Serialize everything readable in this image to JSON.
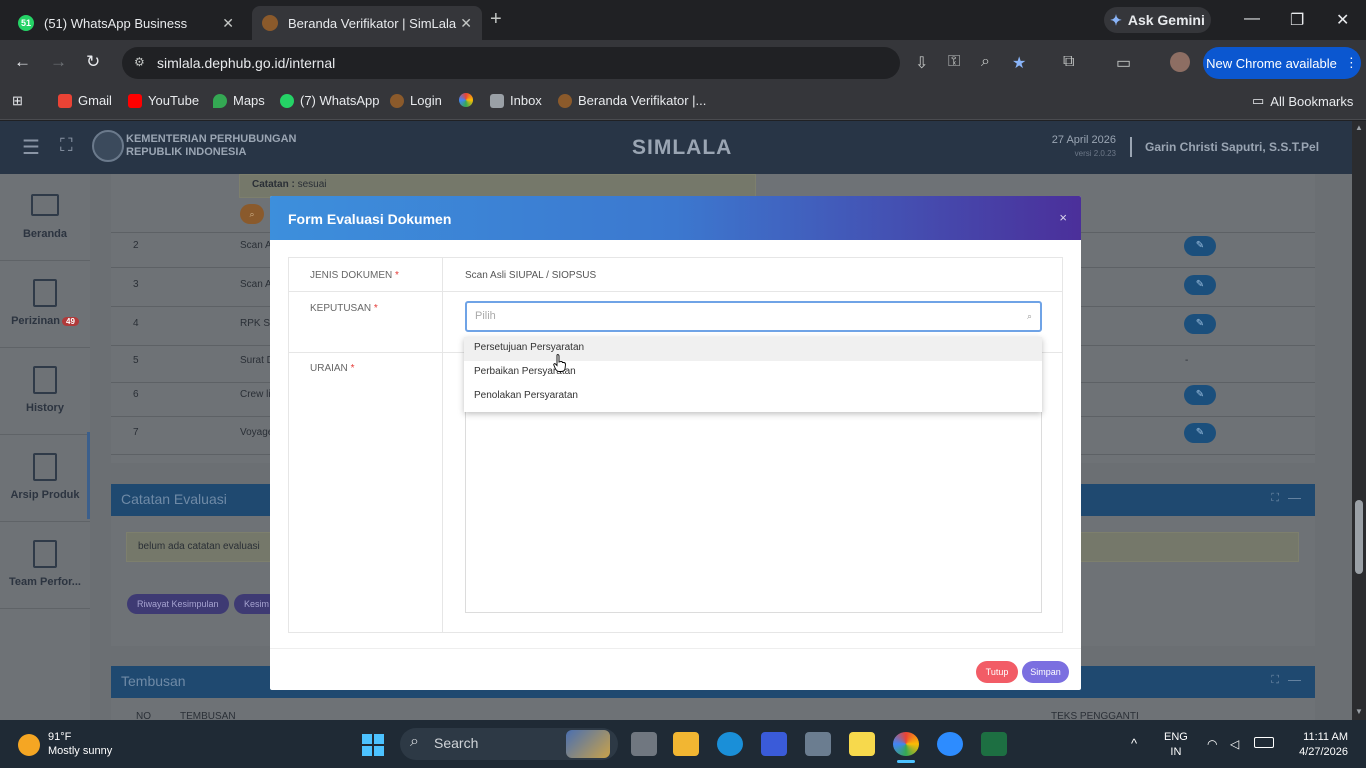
{
  "browser": {
    "tabs": [
      {
        "label": "(51) WhatsApp Business",
        "icon": "whatsapp-icon",
        "favtext": "51",
        "active": false
      },
      {
        "label": "Beranda Verifikator | SimLala",
        "icon": "simlala-icon",
        "favtext": "",
        "active": true
      }
    ],
    "ask_gemini": "Ask Gemini",
    "url": "simlala.dephub.go.id/internal",
    "new_chrome": "New Chrome available",
    "bookmarks": [
      {
        "label": "Gmail",
        "color": "#ea4335"
      },
      {
        "label": "YouTube",
        "color": "#ff0000"
      },
      {
        "label": "Maps",
        "color": "#34a853"
      },
      {
        "label": "(7) WhatsApp",
        "color": "#25d366"
      },
      {
        "label": "Login",
        "color": "#8b5a2b"
      },
      {
        "label": "",
        "color": "#fbbc04"
      },
      {
        "label": "Inbox",
        "color": "#9aa0a6"
      },
      {
        "label": "Beranda Verifikator |...",
        "color": "#8b5a2b"
      }
    ],
    "all_bookmarks": "All Bookmarks"
  },
  "app": {
    "ministry_line1": "KEMENTERIAN PERHUBUNGAN",
    "ministry_line2": "REPUBLIK INDONESIA",
    "brand": "SIMLALA",
    "date": "27 April 2026",
    "version": "versi 2.0.23",
    "user": "Garin Christi Saputri, S.S.T.Pel"
  },
  "sidebar": [
    {
      "label": "Beranda",
      "icon": "monitor-icon",
      "badge": ""
    },
    {
      "label": "Perizinan",
      "icon": "document-icon",
      "badge": "49"
    },
    {
      "label": "History",
      "icon": "document-icon",
      "badge": ""
    },
    {
      "label": "Arsip Produk",
      "icon": "document-icon",
      "badge": ""
    },
    {
      "label": "Team Perfor...",
      "icon": "document-icon",
      "badge": ""
    }
  ],
  "background": {
    "catatan_label": "Catatan :",
    "catatan_value": "sesuai",
    "rows": [
      {
        "no": "2",
        "name": "Scan A",
        "has_edit": true
      },
      {
        "no": "3",
        "name": "Scan A",
        "has_edit": true
      },
      {
        "no": "4",
        "name": "RPK Se",
        "has_edit": true
      },
      {
        "no": "5",
        "name": "Surat D",
        "has_edit": false,
        "dash": "-"
      },
      {
        "no": "6",
        "name": "Crew li",
        "has_edit": true
      },
      {
        "no": "7",
        "name": "Voyage",
        "has_edit": true
      }
    ],
    "catatan_evaluasi_title": "Catatan Evaluasi",
    "catatan_evaluasi_empty": "belum ada catatan evaluasi",
    "riwayat_btn": "Riwayat Kesimpulan",
    "kesim_btn": "Kesim",
    "tembusan_title": "Tembusan",
    "tembusan_cols": [
      "NO",
      "TEMBUSAN",
      "TEKS PENGGANTI"
    ]
  },
  "modal": {
    "title": "Form Evaluasi Dokumen",
    "close": "×",
    "jenis_label": "JENIS DOKUMEN",
    "jenis_value": "Scan Asli SIUPAL / SIOPSUS",
    "keputusan_label": "KEPUTUSAN",
    "placeholder": "Pilih",
    "uraian_label": "URAIAN",
    "required_mark": "*",
    "options": [
      "Persetujuan Persyaratan",
      "Perbaikan Persyaratan",
      "Penolakan Persyaratan"
    ],
    "tutup": "Tutup",
    "simpan": "Simpan"
  },
  "taskbar": {
    "temp": "91°F",
    "weather": "Mostly sunny",
    "search": "Search",
    "lang1": "ENG",
    "lang2": "IN",
    "time": "11:11 AM",
    "date": "4/27/2026"
  }
}
